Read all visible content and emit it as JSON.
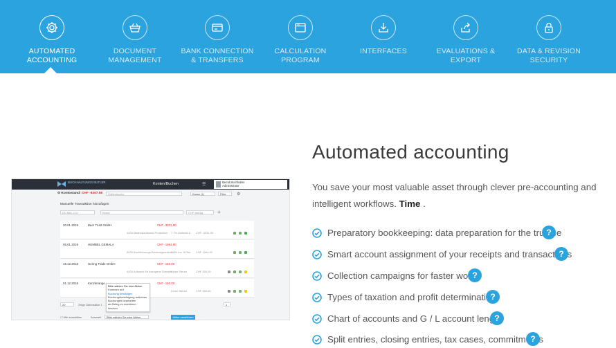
{
  "nav": {
    "items": [
      {
        "label": "AUTOMATED ACCOUNTING",
        "icon": "gear-icon",
        "active": true
      },
      {
        "label": "DOCUMENT MANAGEMENT",
        "icon": "basket-icon"
      },
      {
        "label": "BANK CONNECTION & TRANSFERS",
        "icon": "card-icon"
      },
      {
        "label": "CALCULATION PROGRAM",
        "icon": "window-icon"
      },
      {
        "label": "INTERFACES",
        "icon": "download-icon"
      },
      {
        "label": "EVALUATIONS & EXPORT",
        "icon": "share-icon"
      },
      {
        "label": "DATA & REVISION SECURITY",
        "icon": "lock-icon"
      }
    ]
  },
  "mock": {
    "logo": "BUCHHALTUNGS BUTLER",
    "title": "Konten/Buchen",
    "user_name": "Bernd Buchhalter",
    "user_role": "Administrator",
    "konto_label": "Kontostand:",
    "konto_value": "CHF -8367.58",
    "search_placeholder": "Volltextsuche",
    "account_select": "Kasse (1)",
    "filter_label": "Filter",
    "section": "Manuelle Transaktion hinzufügen",
    "date_placeholder": "DD.MM.JJJJ",
    "text_placeholder": "Kennt",
    "amount_placeholder": "CHF Betrag",
    "rows": [
      {
        "date": "20.01.2019",
        "name": "Beer Trust GmbH",
        "amount": "CHF -3331.90",
        "sub": "4400 Materialaufwand Produktion",
        "rate": "7.7% Material &",
        "amt2": "CHF -3331.90"
      },
      {
        "date": "05.01.2019",
        "name": "HUMBEL GEMALA",
        "amount": "CHF -1964.90",
        "sub": "6020 Buchführungs-Beratungsaufwand",
        "rate": "7.7% Inv. & Dim",
        "amt2": "CHF 1964.90"
      },
      {
        "date": "15.12.2018",
        "name": "Gering Trade GmbH",
        "amount": "CHF -150.00",
        "sub": "4400 Aufwand für bezogene Dienstle...",
        "rate": "Keine Steuer",
        "amt2": "CHF 150.00"
      },
      {
        "date": "01.12.2018",
        "name": "Kanzlerange",
        "amount": "CHF -160.00",
        "sub": "",
        "rate": "Keine Steuer",
        "amt2": "CHF 160.00"
      }
    ],
    "dropdown": {
      "title": "Bitte wählen Sie eine Aktion",
      "items": [
        "Kommen auf",
        "Buchung bestätigen",
        "Buchungsbestätigung aufheben",
        "Buchungen bearbeiten",
        "als Beleg zu markieren",
        "löschen"
      ]
    },
    "per_page": "20",
    "per_page_label": "Zeige Datensätze 1",
    "select_all": "Alle auswählen",
    "action_label": "Auswahl",
    "action_select": "Bitte wählen Sie eine Aktion",
    "action_button": "Aktion ausführen",
    "page_num": "1"
  },
  "content": {
    "title": "Automated accounting",
    "intro_text": "You save your most valuable asset through clever pre-accounting and intelligent workflows.",
    "intro_bold": "Time",
    "intro_end": ".",
    "features": [
      "Preparatory bookkeeping: data preparation for the trustee",
      "Smart account assignment of your receipts and transactions",
      "Collection campaigns for faster work",
      "Types of taxation and profit determination",
      "Chart of accounts and G / L account length",
      "Split entries, closing entries, tax cases, commitments"
    ],
    "help_glyph": "?"
  },
  "colors": {
    "accent": "#2ba3de",
    "negative": "#e0312b",
    "text": "#555555"
  }
}
